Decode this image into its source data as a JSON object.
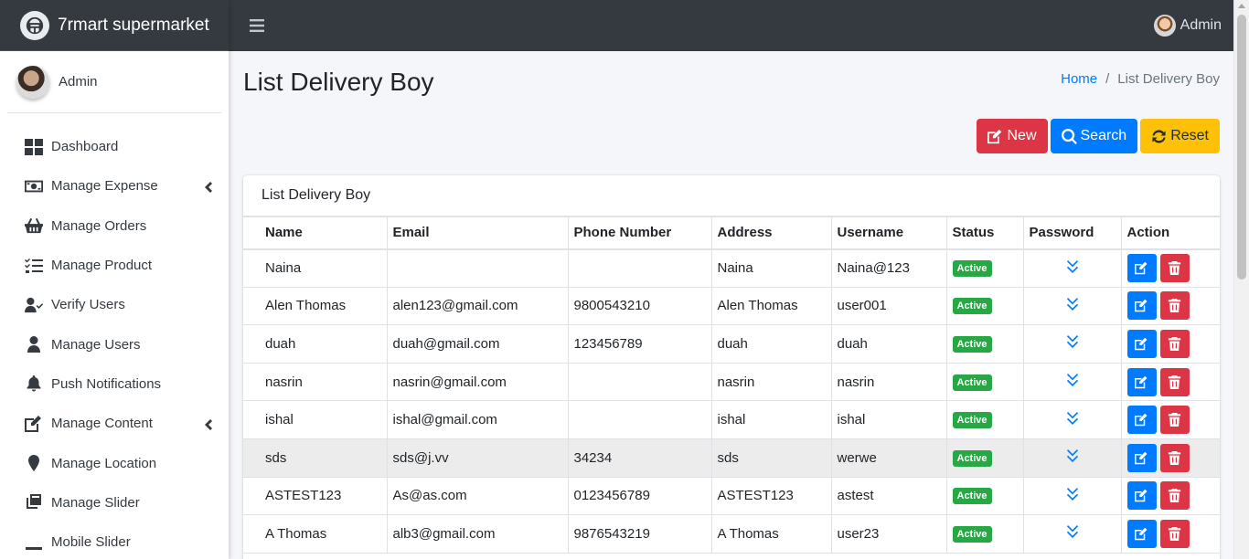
{
  "brand": {
    "title": "7rmart supermarket"
  },
  "sidebar": {
    "user": "Admin",
    "items": [
      {
        "label": "Dashboard",
        "icon": "dashboard-icon",
        "has_submenu": false
      },
      {
        "label": "Manage Expense",
        "icon": "money-bill-icon",
        "has_submenu": true
      },
      {
        "label": "Manage Orders",
        "icon": "shopping-basket-icon",
        "has_submenu": false
      },
      {
        "label": "Manage Product",
        "icon": "tasks-icon",
        "has_submenu": false
      },
      {
        "label": "Verify Users",
        "icon": "user-check-icon",
        "has_submenu": false
      },
      {
        "label": "Manage Users",
        "icon": "user-icon",
        "has_submenu": false
      },
      {
        "label": "Push Notifications",
        "icon": "bell-icon",
        "has_submenu": false
      },
      {
        "label": "Manage Content",
        "icon": "edit-icon",
        "has_submenu": true
      },
      {
        "label": "Manage Location",
        "icon": "map-marker-icon",
        "has_submenu": false
      },
      {
        "label": "Manage Slider",
        "icon": "clone-icon",
        "has_submenu": false
      },
      {
        "label": "Mobile Slider",
        "icon": "minus-icon",
        "has_submenu": false
      }
    ]
  },
  "topbar": {
    "user": "Admin"
  },
  "page": {
    "title": "List Delivery Boy",
    "breadcrumb": {
      "home": "Home",
      "separator": "/",
      "current": "List Delivery Boy"
    }
  },
  "actions": {
    "new": "New",
    "search": "Search",
    "reset": "Reset"
  },
  "card": {
    "title": "List Delivery Boy"
  },
  "table": {
    "headers": [
      "Name",
      "Email",
      "Phone Number",
      "Address",
      "Username",
      "Status",
      "Password",
      "Action"
    ],
    "rows": [
      {
        "name": "Naina",
        "email": "",
        "phone": "",
        "address": "Naina",
        "username": "Naina@123",
        "status": "Active"
      },
      {
        "name": "Alen Thomas",
        "email": "alen123@gmail.com",
        "phone": "9800543210",
        "address": "Alen Thomas",
        "username": "user001",
        "status": "Active"
      },
      {
        "name": "duah",
        "email": "duah@gmail.com",
        "phone": "123456789",
        "address": "duah",
        "username": "duah",
        "status": "Active"
      },
      {
        "name": "nasrin",
        "email": "nasrin@gmail.com",
        "phone": "",
        "address": "nasrin",
        "username": "nasrin",
        "status": "Active"
      },
      {
        "name": "ishal",
        "email": "ishal@gmail.com",
        "phone": "",
        "address": "ishal",
        "username": "ishal",
        "status": "Active"
      },
      {
        "name": "sds",
        "email": "sds@j.vv",
        "phone": "34234",
        "address": "sds",
        "username": "werwe",
        "status": "Active"
      },
      {
        "name": "ASTEST123",
        "email": "As@as.com",
        "phone": "0123456789",
        "address": "ASTEST123",
        "username": "astest",
        "status": "Active"
      },
      {
        "name": "A Thomas",
        "email": "alb3@gmail.com",
        "phone": "9876543219",
        "address": "A Thomas",
        "username": "user23",
        "status": "Active"
      }
    ]
  },
  "colors": {
    "topbar": "#343a40",
    "primary": "#007bff",
    "danger": "#dc3545",
    "warning": "#ffc107",
    "success": "#28a745"
  }
}
